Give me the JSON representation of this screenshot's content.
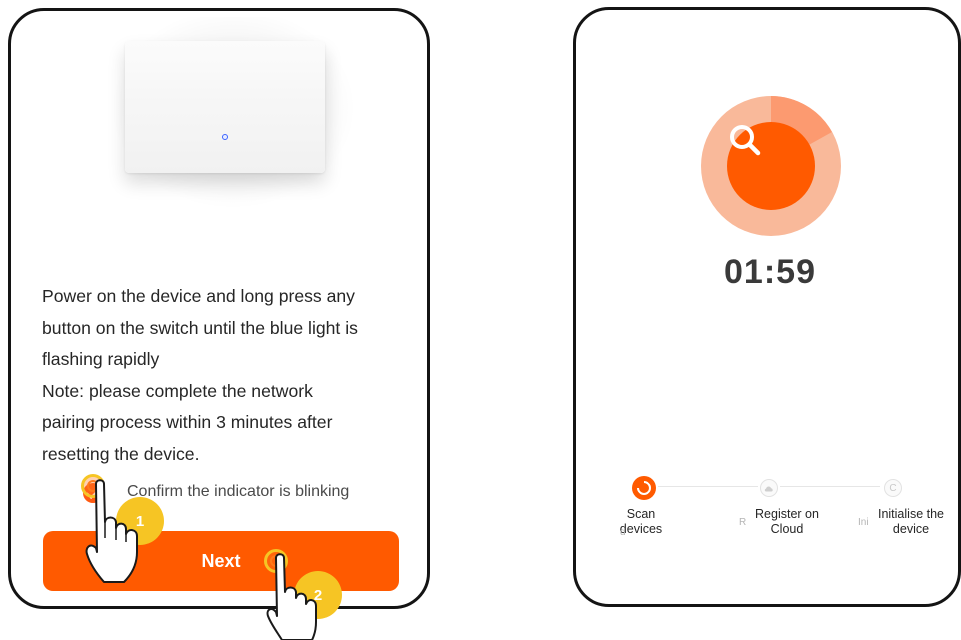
{
  "left_screen": {
    "instruction_lines": [
      "Power on the device and long press any",
      "button on the switch until the blue light is",
      "flashing rapidly",
      "Note: please complete the network",
      "pairing process within 3 minutes after",
      "resetting the device."
    ],
    "confirm_label": "Confirm the indicator is blinking",
    "confirm_checked": true,
    "next_label": "Next",
    "annotations": [
      "1",
      "2"
    ]
  },
  "right_screen": {
    "timer": "01:59",
    "steps": [
      {
        "label_line1": "Scan",
        "label_line2": "devices",
        "ghost": "d",
        "state": "active"
      },
      {
        "label_line1": "Register on",
        "label_line2": "Cloud",
        "ghost": "R",
        "state": "pending"
      },
      {
        "label_line1": "Initialise the",
        "label_line2": "device",
        "ghost": "Ini",
        "state": "pending"
      }
    ]
  },
  "icons": {
    "scan": "search-icon",
    "step_active": "radio-ring-icon",
    "step_cloud": "cloud-icon",
    "step_device": "device-c-icon",
    "hand": "pointing-hand-icon"
  },
  "colors": {
    "accent": "#ff5a00",
    "accent_light": "#f9b99a",
    "tap_ring": "#f6c524",
    "led": "#3b62ff",
    "frame": "#141414"
  }
}
